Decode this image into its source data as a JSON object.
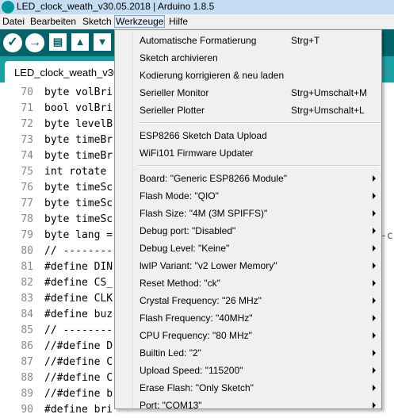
{
  "window": {
    "title": "LED_clock_weath_v30.05.2018 | Arduino 1.8.5"
  },
  "menubar": [
    {
      "label": "Datei"
    },
    {
      "label": "Bearbeiten"
    },
    {
      "label": "Sketch"
    },
    {
      "label": "Werkzeuge",
      "active": true
    },
    {
      "label": "Hilfe"
    }
  ],
  "toolbar": {
    "verify": "✓",
    "upload": "→",
    "new": "▤",
    "open": "▲",
    "save": "▼"
  },
  "tabs": {
    "active": "LED_clock_weath_v30",
    "right_fragment": "_pc"
  },
  "editor": {
    "lines": [
      {
        "n": "70",
        "code": "byte volBri"
      },
      {
        "n": "71",
        "code": "bool volBri"
      },
      {
        "n": "72",
        "code": "byte levelB"
      },
      {
        "n": "73",
        "code": "byte timeBr"
      },
      {
        "n": "74",
        "code": "byte timeBr"
      },
      {
        "n": "75",
        "code": "int rotate"
      },
      {
        "n": "76",
        "code": "byte timeSc"
      },
      {
        "n": "77",
        "code": "byte timeSc"
      },
      {
        "n": "78",
        "code": "byte timeSc"
      },
      {
        "n": "79",
        "code": "byte lang ="
      },
      {
        "n": "80",
        "code": "// --------"
      },
      {
        "n": "81",
        "code": "#define DIN"
      },
      {
        "n": "82",
        "code": "#define CS_"
      },
      {
        "n": "83",
        "code": "#define CLK"
      },
      {
        "n": "84",
        "code": "#define buz"
      },
      {
        "n": "85",
        "code": "// --------"
      },
      {
        "n": "86",
        "code": "//#define D"
      },
      {
        "n": "87",
        "code": "//#define C"
      },
      {
        "n": "88",
        "code": "//#define C"
      },
      {
        "n": "89",
        "code": "//#define b"
      },
      {
        "n": "90",
        "code": "#define bri"
      }
    ],
    "side_fragment": "-cs"
  },
  "menu": {
    "groups": [
      [
        {
          "label": "Automatische Formatierung",
          "shortcut": "Strg+T"
        },
        {
          "label": "Sketch archivieren"
        },
        {
          "label": "Kodierung korrigieren & neu laden"
        },
        {
          "label": "Serieller Monitor",
          "shortcut": "Strg+Umschalt+M"
        },
        {
          "label": "Serieller Plotter",
          "shortcut": "Strg+Umschalt+L"
        }
      ],
      [
        {
          "label": "ESP8266 Sketch Data Upload"
        },
        {
          "label": "WiFi101 Firmware Updater"
        }
      ],
      [
        {
          "label": "Board: \"Generic ESP8266 Module\"",
          "submenu": true
        },
        {
          "label": "Flash Mode: \"QIO\"",
          "submenu": true
        },
        {
          "label": "Flash Size: \"4M (3M SPIFFS)\"",
          "submenu": true
        },
        {
          "label": "Debug port: \"Disabled\"",
          "submenu": true
        },
        {
          "label": "Debug Level: \"Keine\"",
          "submenu": true
        },
        {
          "label": "lwIP Variant: \"v2 Lower Memory\"",
          "submenu": true
        },
        {
          "label": "Reset Method: \"ck\"",
          "submenu": true
        },
        {
          "label": "Crystal Frequency: \"26 MHz\"",
          "submenu": true
        },
        {
          "label": "Flash Frequency: \"40MHz\"",
          "submenu": true
        },
        {
          "label": "CPU Frequency: \"80 MHz\"",
          "submenu": true
        },
        {
          "label": "Builtin Led: \"2\"",
          "submenu": true
        },
        {
          "label": "Upload Speed: \"115200\"",
          "submenu": true
        },
        {
          "label": "Erase Flash: \"Only Sketch\"",
          "submenu": true
        },
        {
          "label": "Port: \"COM13\"",
          "submenu": true
        }
      ]
    ]
  }
}
